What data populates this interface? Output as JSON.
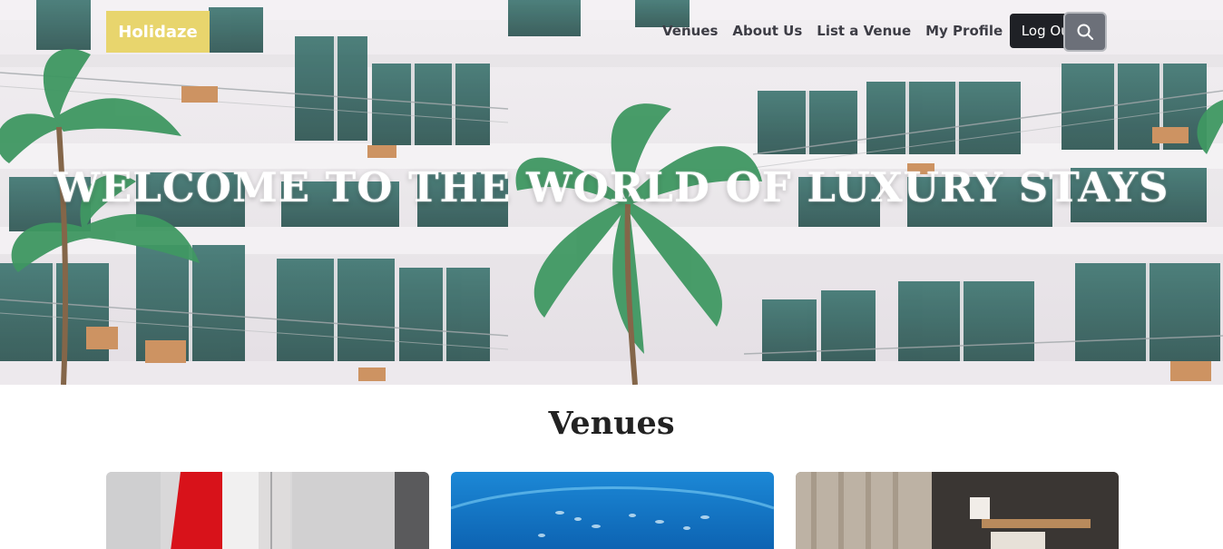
{
  "nav": {
    "logo": "Holidaze",
    "links": [
      "Venues",
      "About Us",
      "List a Venue",
      "My Profile"
    ],
    "logout_label": "Log Out",
    "search_icon": "search-icon"
  },
  "hero": {
    "title": "WELCOME TO THE WORLD OF LUXURY STAYS"
  },
  "venues": {
    "title": "Venues",
    "cards": [
      {
        "image": "white-room-red-stripe"
      },
      {
        "image": "underwater-aquarium"
      },
      {
        "image": "hotel-bedroom"
      }
    ]
  },
  "colors": {
    "logo_bg": "#e8d56d",
    "logout_bg": "#1f2126",
    "search_bg": "#6c7079",
    "nav_text": "#3d3d45"
  }
}
